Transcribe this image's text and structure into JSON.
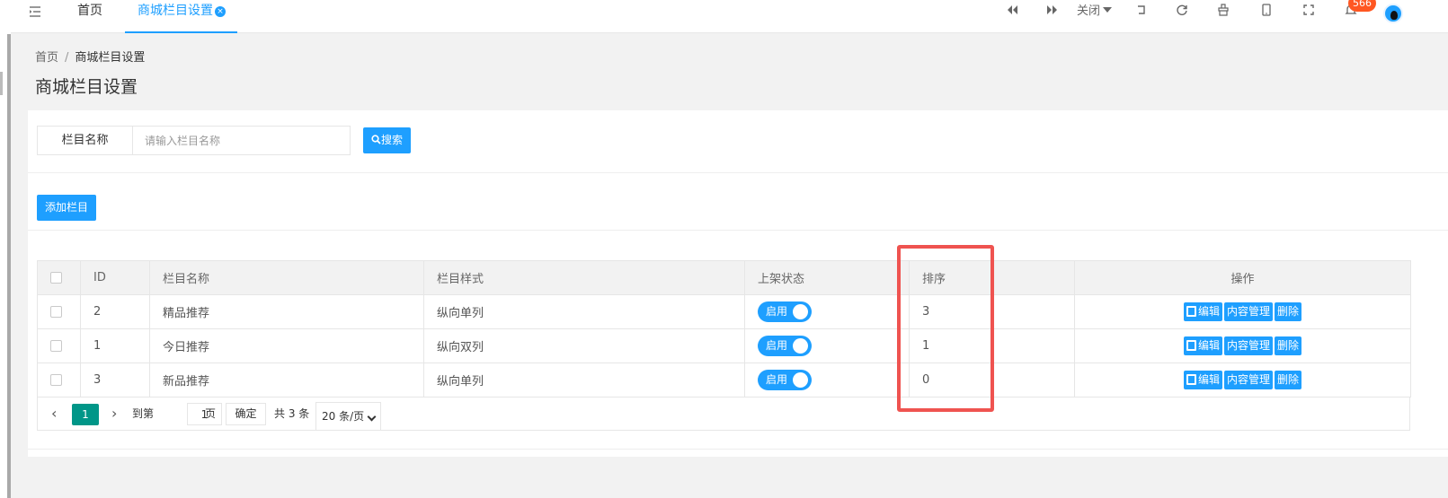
{
  "header": {
    "tabs": [
      {
        "label": "首页"
      },
      {
        "label": "商城栏目设置"
      }
    ],
    "tab_close_symbol": "×",
    "close_label": "关闭",
    "notification_count": "566"
  },
  "breadcrumb": {
    "home": "首页",
    "separator": "/",
    "current": "商城栏目设置"
  },
  "page_title": "商城栏目设置",
  "search": {
    "label": "栏目名称",
    "placeholder": "请输入栏目名称",
    "value": "",
    "button_label": "搜索"
  },
  "add_button_label": "添加栏目",
  "table": {
    "columns": [
      "ID",
      "栏目名称",
      "栏目样式",
      "上架状态",
      "排序",
      "操作"
    ],
    "rows": [
      {
        "id": "2",
        "name": "精品推荐",
        "style": "纵向单列",
        "status": "启用",
        "sort": "3"
      },
      {
        "id": "1",
        "name": "今日推荐",
        "style": "纵向双列",
        "status": "启用",
        "sort": "1"
      },
      {
        "id": "3",
        "name": "新品推荐",
        "style": "纵向单列",
        "status": "启用",
        "sort": "0"
      }
    ],
    "actions": {
      "edit": "编辑",
      "content": "内容管理",
      "delete": "删除"
    }
  },
  "pager": {
    "prev_symbol": "‹",
    "next_symbol": "›",
    "current_page": "1",
    "goto_label": "到第",
    "goto_value": "1",
    "page_unit": "页",
    "confirm_label": "确定",
    "total_label": "共 3 条",
    "page_size_label": "20 条/页"
  },
  "colors": {
    "accent": "#1e9fff",
    "pager_active": "#009688",
    "badge": "#ff5722",
    "highlight": "#ef5350"
  }
}
